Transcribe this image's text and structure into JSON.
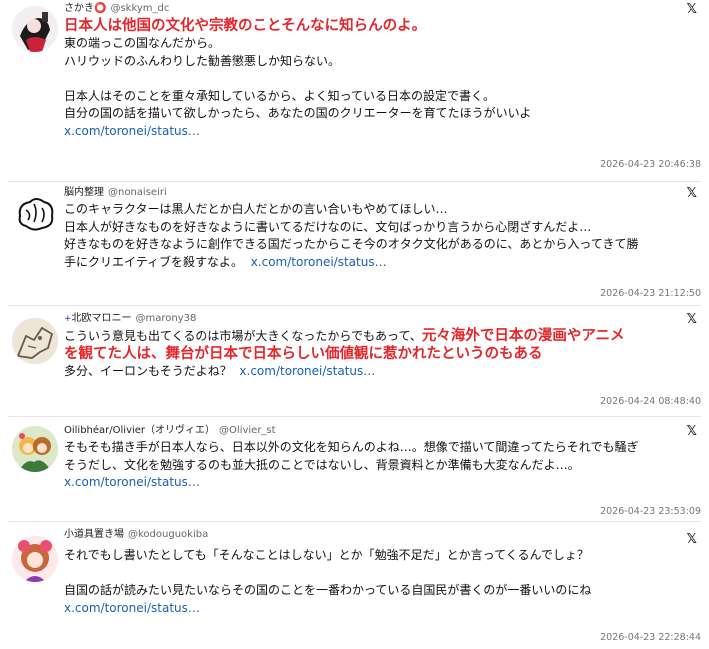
{
  "tweets": [
    {
      "name": "さかき⭕",
      "handle": "@skkym_dc",
      "lines": [
        "日本人は他国の文化や宗教のことそんなに知らんのよ。",
        "東の端っこの国なんだから。",
        "ハリウッドのふんわりした勧善懲悪しか知らない。",
        "",
        "日本人はそのことを重々承知しているから、よく知っている日本の設定で書く。",
        "自分の国の話を描いて欲しかったら、あなたの国のクリエーターを育てたほうがいいよ"
      ],
      "link": "x.com/toronei/status…",
      "timestamp": "2026-04-23 20:46:38"
    },
    {
      "name": "脳内整理",
      "handle": "@nonaiseiri",
      "lines": [
        "このキャラクターは黒人だとか白人だとかの言い合いもやめてほしい…",
        "日本人が好きなものを好きなように書いてるだけなのに、文句ばっかり言うから心閉ざすんだよ…",
        "好きなものを好きなように創作できる国だったからこそ今のオタク文化があるのに、あとから入ってきて勝",
        "手にクリエイティブを殺すなよ。"
      ],
      "link": "x.com/toronei/status…",
      "timestamp": "2026-04-23 21:12:50"
    },
    {
      "name_flag": "+",
      "name": "北欧マロニー",
      "handle": "@marony38",
      "line1_plain": "こういう意見も出てくるのは市場が大きくなったからでもあって、",
      "line1_red": "元々海外で日本の漫画やアニメ",
      "line2_red": "を観てた人は、舞台が日本で日本らしい価値観に惹かれたというのもある",
      "line3": "多分、イーロンもそうだよね？",
      "link": "x.com/toronei/status…",
      "timestamp": "2026-04-24 08:48:40"
    },
    {
      "name": "Oilibhéar/Olivier（オリヴィエ）",
      "handle": "@Olivier_st",
      "lines": [
        "そもそも描き手が日本人なら、日本以外の文化を知らんのよね…。想像で描いて間違ってたらそれでも騒ぎ",
        "そうだし、文化を勉強するのも並大抵のことではないし、背景資料とか準備も大変なんだよ…。"
      ],
      "link": "x.com/toronei/status…",
      "timestamp": "2026-04-23 23:53:09"
    },
    {
      "name": "小道具置き場",
      "handle": "@kodouguokiba",
      "lines": [
        "それでもし書いたとしても「そんなことはしない」とか「勉強不足だ」とか言ってくるんでしょ？",
        "",
        "自国の話が読みたい見たいならその国のことを一番わかっている自国民が書くのが一番いいのにね"
      ],
      "link": "x.com/toronei/status…",
      "timestamp": "2026-04-23 22:28:44"
    }
  ],
  "x_glyph": "𝕏"
}
